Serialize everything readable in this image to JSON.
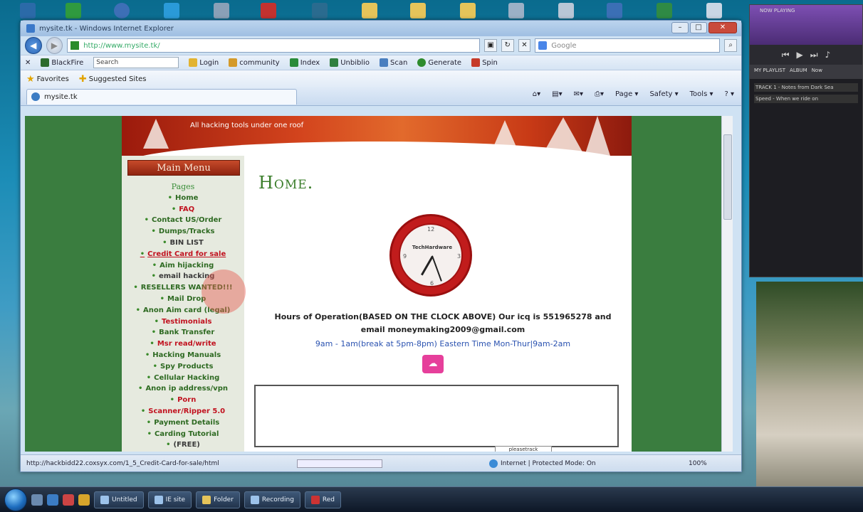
{
  "window": {
    "title": "mysite.tk - Windows Internet Explorer",
    "controls": [
      "–",
      "□",
      "✕"
    ]
  },
  "address_bar": {
    "url": "http://www.mysite.tk/",
    "search_placeholder": "Google"
  },
  "toolbar": {
    "items": [
      "BlackFire",
      "Search",
      "Login",
      "community",
      "Index",
      "Unbiblio",
      "Scan",
      "Generate",
      "Spin"
    ]
  },
  "favorites_bar": {
    "favorites_label": "Favorites",
    "suggested_sites": "Suggested Sites"
  },
  "tab": {
    "label": "mysite.tk"
  },
  "command_bar": {
    "page": "Page ▾",
    "safety": "Safety ▾",
    "tools": "Tools ▾",
    "help": "? ▾"
  },
  "site": {
    "tagline": "All hacking tools under one roof",
    "menu_title": "Main Menu",
    "menu": [
      {
        "label": "Pages",
        "style": "heading"
      },
      {
        "label": "Home",
        "style": "c-green"
      },
      {
        "label": "FAQ",
        "style": "c-red"
      },
      {
        "label": "Contact US/Order",
        "style": "c-green"
      },
      {
        "label": "Dumps/Tracks",
        "style": "c-green"
      },
      {
        "label": "BIN LIST",
        "style": "c-dark"
      },
      {
        "label": "Credit Card for sale",
        "style": "hover-item"
      },
      {
        "label": "Aim hijacking",
        "style": "c-green"
      },
      {
        "label": "email hacking",
        "style": "c-dark"
      },
      {
        "label": "RESELLERS WANTED!!!",
        "style": "c-green"
      },
      {
        "label": "Mail Drop",
        "style": "c-green"
      },
      {
        "label": "Anon Aim card (legal)",
        "style": "c-green"
      },
      {
        "label": "Testimonials",
        "style": "c-red"
      },
      {
        "label": "Bank Transfer",
        "style": "c-green"
      },
      {
        "label": "Msr read/write",
        "style": "c-red"
      },
      {
        "label": "Hacking Manuals",
        "style": "c-green"
      },
      {
        "label": "Spy Products",
        "style": "c-green"
      },
      {
        "label": "Cellular Hacking",
        "style": "c-green"
      },
      {
        "label": "Anon ip address/vpn",
        "style": "c-green"
      },
      {
        "label": "Porn",
        "style": "c-red"
      },
      {
        "label": "Scanner/Ripper 5.0",
        "style": "c-red"
      },
      {
        "label": "Payment Details",
        "style": "c-green"
      },
      {
        "label": "Carding Tutorial",
        "style": "c-green"
      },
      {
        "label": "(FREE)",
        "style": "c-dark"
      }
    ],
    "page_heading": "Home.",
    "clock": {
      "brand": "TechHardware",
      "numbers": {
        "twelve": "12",
        "three": "3",
        "six": "6",
        "nine": "9"
      }
    },
    "hours_line": "Hours of Operation(BASED ON THE CLOCK ABOVE) Our icq is 551965278 and email moneymaking2009@gmail.com",
    "hours_line2": "9am - 1am(break at 5pm-8pm) Eastern Time Mon-Thur|9am-2am",
    "counter_badge": "pleasetrack"
  },
  "status_bar": {
    "url": "http://hackbidd22.coxsyx.com/1_5_Credit-Card-for-sale/html",
    "zone": "Internet | Protected Mode: On",
    "zoom": "100%"
  },
  "media_player": {
    "title": "NOW PLAYING",
    "tabs": [
      "MY PLAYLIST",
      "ALBUM",
      "Now"
    ],
    "list": [
      "TRACK 1 - Notes from Dark Sea",
      "Speed - When we ride on"
    ]
  },
  "taskbar": {
    "buttons": [
      "Untitled",
      "IE site",
      "Folder",
      "Recording",
      "Red"
    ]
  },
  "colors": {
    "site_green": "#3a7d3f",
    "header_orange": "#d3441d",
    "menu_red": "#c1121f"
  }
}
